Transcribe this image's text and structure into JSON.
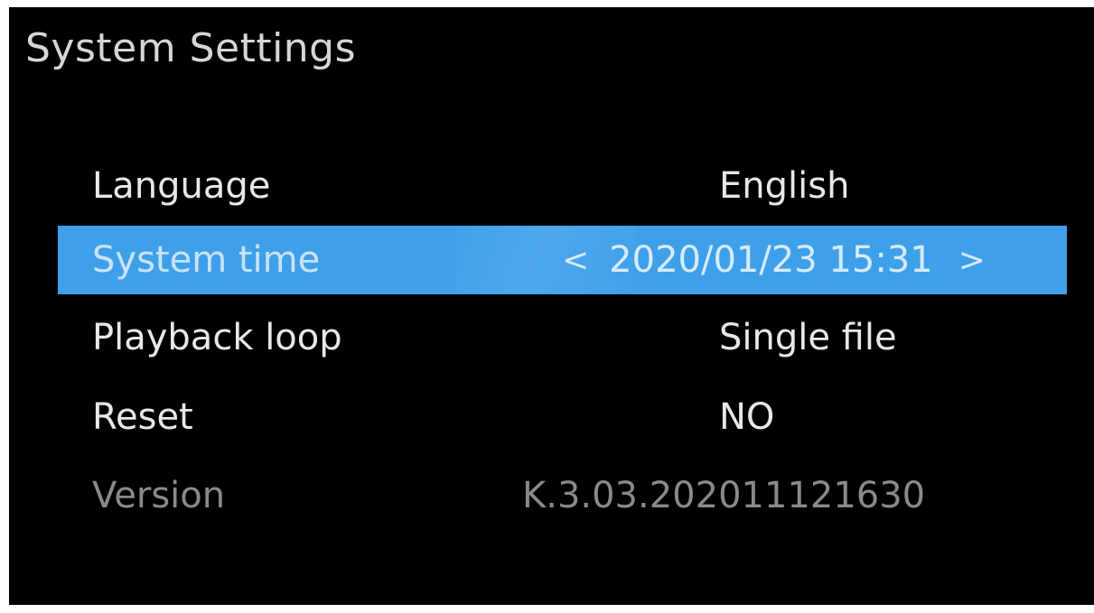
{
  "header": {
    "title": "System Settings"
  },
  "settings": [
    {
      "label": "Language",
      "value": "English"
    },
    {
      "label": "System time",
      "value": "2020/01/23 15:31",
      "prev": "<",
      "next": ">"
    },
    {
      "label": "Playback loop",
      "value": "Single file"
    },
    {
      "label": "Reset",
      "value": "NO"
    },
    {
      "label": "Version",
      "value": "K.3.03.202011121630"
    }
  ],
  "colors": {
    "background": "#000000",
    "highlight": "#3fa0ea",
    "text": "#e8e8e8",
    "disabled_text": "#8a8a8a"
  }
}
